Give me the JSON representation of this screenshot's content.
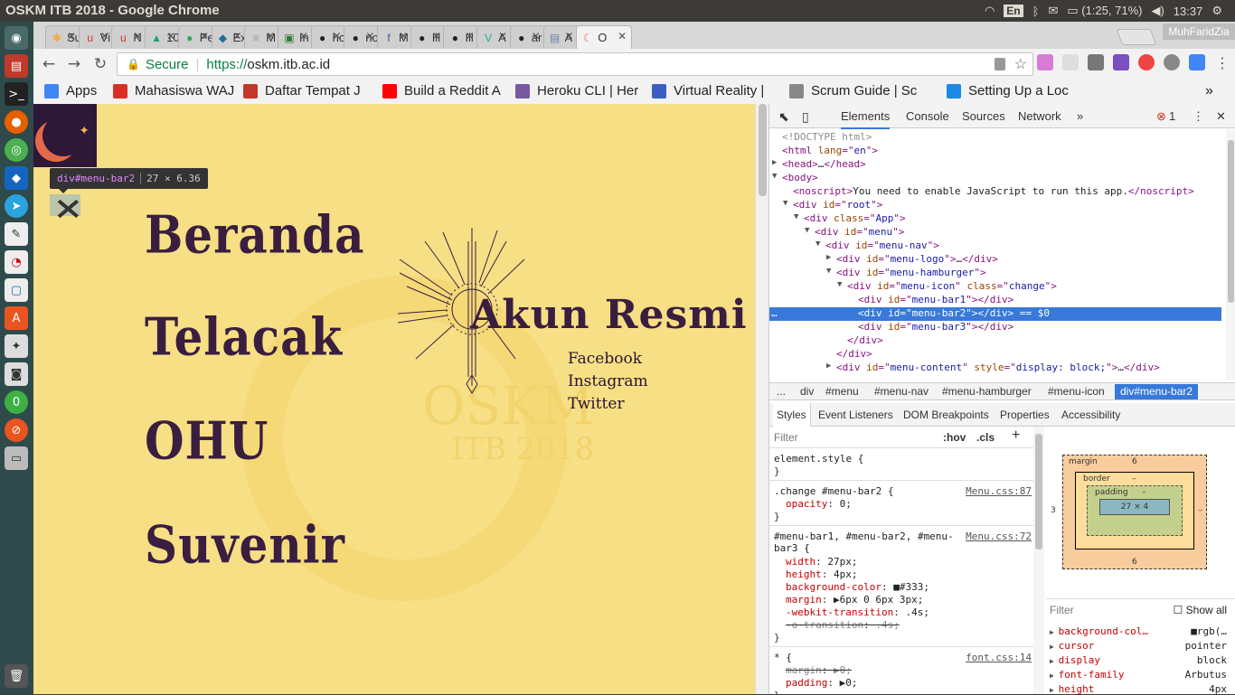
{
  "system": {
    "window_title": "OSKM ITB 2018 - Google Chrome",
    "keyboard_layout": "En",
    "battery": "(1:25, 71%)",
    "clock": "13:37"
  },
  "browser": {
    "profile_name": "MuhFaridZia",
    "tabs": [
      {
        "label": "Su",
        "color": "#f4a742",
        "icon_glyph": "✱"
      },
      {
        "label": "Vi",
        "color": "#d93025",
        "icon_glyph": "u"
      },
      {
        "label": "N",
        "color": "#d93025",
        "icon_glyph": "u"
      },
      {
        "label": "10",
        "color": "#1ea362",
        "icon_glyph": "▲"
      },
      {
        "label": "Pe",
        "color": "#2fa84f",
        "icon_glyph": "●"
      },
      {
        "label": "Ex",
        "color": "#1f6f9f",
        "icon_glyph": "◆"
      },
      {
        "label": "M",
        "color": "#999999",
        "icon_glyph": "≡"
      },
      {
        "label": "In",
        "color": "#2e7d32",
        "icon_glyph": "▣"
      },
      {
        "label": "ho",
        "color": "#222222",
        "icon_glyph": "●"
      },
      {
        "label": "no",
        "color": "#222222",
        "icon_glyph": "●"
      },
      {
        "label": "M",
        "color": "#3b5998",
        "icon_glyph": "f"
      },
      {
        "label": "Ill",
        "color": "#222222",
        "icon_glyph": "●"
      },
      {
        "label": "Ill",
        "color": "#222222",
        "icon_glyph": "●"
      },
      {
        "label": "A",
        "color": "#1fae9b",
        "icon_glyph": "V"
      },
      {
        "label": "ar",
        "color": "#222222",
        "icon_glyph": "●"
      },
      {
        "label": "A",
        "color": "#6f7fa8",
        "icon_glyph": "▤"
      },
      {
        "label": "O",
        "color": "#e4694a",
        "icon_glyph": "☾"
      }
    ],
    "omnibox": {
      "secure_label": "Secure",
      "separator": "|",
      "url_scheme": "https://",
      "url_host": "oskm.itb.ac.id"
    },
    "bookmarks": [
      {
        "label": "Apps",
        "color": "#4285f4"
      },
      {
        "label": "Mahasiswa WAJ",
        "color": "#d93025"
      },
      {
        "label": "Daftar Tempat J",
        "color": "#c0392b"
      },
      {
        "label": "Build a Reddit A",
        "color": "#ff0000"
      },
      {
        "label": "Heroku CLI | Her",
        "color": "#79589f"
      },
      {
        "label": "Virtual Reality |",
        "color": "#3b5fc0"
      },
      {
        "label": "Scrum Guide | Sc",
        "color": "#888888"
      },
      {
        "label": "Setting Up a Loc",
        "color": "#1e88e5"
      }
    ],
    "bookmarks_overflow": "»"
  },
  "page": {
    "nav_links": [
      "Beranda",
      "Telacak",
      "OHU",
      "Suvenir"
    ],
    "akun_title": "Akun Resmi",
    "social_links": [
      "Facebook",
      "Instagram",
      "Twitter"
    ],
    "watermark_main": "OSKM",
    "watermark_sub": "ITB 2018",
    "inspect_tooltip": {
      "tag": "div#menu-bar2",
      "dims": "27 × 6.36"
    }
  },
  "devtools": {
    "tabs": [
      "Elements",
      "Console",
      "Sources",
      "Network"
    ],
    "more": "»",
    "error_count": "1",
    "dom_lines": [
      {
        "indent": 0,
        "arrow": "",
        "parts": [
          [
            "cm",
            "<!DOCTYPE html>"
          ]
        ]
      },
      {
        "indent": 0,
        "arrow": "",
        "parts": [
          [
            "tg",
            "<html "
          ],
          [
            "an",
            "lang"
          ],
          [
            "tg",
            "=\""
          ],
          [
            "av",
            "en"
          ],
          [
            "tg",
            "\">"
          ]
        ]
      },
      {
        "indent": 0,
        "arrow": "▶",
        "parts": [
          [
            "tg",
            "<head>"
          ],
          [
            "tx",
            "…"
          ],
          [
            "tg",
            "</head>"
          ]
        ]
      },
      {
        "indent": 0,
        "arrow": "▼",
        "parts": [
          [
            "tg",
            "<body>"
          ]
        ]
      },
      {
        "indent": 1,
        "arrow": "",
        "parts": [
          [
            "tg",
            "<noscript>"
          ],
          [
            "tx",
            "You need to enable JavaScript to run this app."
          ],
          [
            "tg",
            "</noscript>"
          ]
        ]
      },
      {
        "indent": 1,
        "arrow": "▼",
        "parts": [
          [
            "tg",
            "<div "
          ],
          [
            "an",
            "id"
          ],
          [
            "tg",
            "=\""
          ],
          [
            "av",
            "root"
          ],
          [
            "tg",
            "\">"
          ]
        ]
      },
      {
        "indent": 2,
        "arrow": "▼",
        "parts": [
          [
            "tg",
            "<div "
          ],
          [
            "an",
            "class"
          ],
          [
            "tg",
            "=\""
          ],
          [
            "av",
            "App"
          ],
          [
            "tg",
            "\">"
          ]
        ]
      },
      {
        "indent": 3,
        "arrow": "▼",
        "parts": [
          [
            "tg",
            "<div "
          ],
          [
            "an",
            "id"
          ],
          [
            "tg",
            "=\""
          ],
          [
            "av",
            "menu"
          ],
          [
            "tg",
            "\">"
          ]
        ]
      },
      {
        "indent": 4,
        "arrow": "▼",
        "parts": [
          [
            "tg",
            "<div "
          ],
          [
            "an",
            "id"
          ],
          [
            "tg",
            "=\""
          ],
          [
            "av",
            "menu-nav"
          ],
          [
            "tg",
            "\">"
          ]
        ]
      },
      {
        "indent": 5,
        "arrow": "▶",
        "parts": [
          [
            "tg",
            "<div "
          ],
          [
            "an",
            "id"
          ],
          [
            "tg",
            "=\""
          ],
          [
            "av",
            "menu-logo"
          ],
          [
            "tg",
            "\">"
          ],
          [
            "tx",
            "…"
          ],
          [
            "tg",
            "</div>"
          ]
        ]
      },
      {
        "indent": 5,
        "arrow": "▼",
        "parts": [
          [
            "tg",
            "<div "
          ],
          [
            "an",
            "id"
          ],
          [
            "tg",
            "=\""
          ],
          [
            "av",
            "menu-hamburger"
          ],
          [
            "tg",
            "\">"
          ]
        ]
      },
      {
        "indent": 6,
        "arrow": "▼",
        "parts": [
          [
            "tg",
            "<div "
          ],
          [
            "an",
            "id"
          ],
          [
            "tg",
            "=\""
          ],
          [
            "av",
            "menu-icon"
          ],
          [
            "tg",
            "\" "
          ],
          [
            "an",
            "class"
          ],
          [
            "tg",
            "=\""
          ],
          [
            "av",
            "change"
          ],
          [
            "tg",
            "\">"
          ]
        ]
      },
      {
        "indent": 7,
        "arrow": "",
        "parts": [
          [
            "tg",
            "<div "
          ],
          [
            "an",
            "id"
          ],
          [
            "tg",
            "=\""
          ],
          [
            "av",
            "menu-bar1"
          ],
          [
            "tg",
            "\"></div>"
          ]
        ]
      },
      {
        "indent": 7,
        "arrow": "",
        "selected": true,
        "parts": [
          [
            "tg",
            "<div "
          ],
          [
            "an",
            "id"
          ],
          [
            "tg",
            "=\""
          ],
          [
            "av",
            "menu-bar2"
          ],
          [
            "tg",
            "\"></div>"
          ],
          [
            "tx",
            " == $0"
          ]
        ]
      },
      {
        "indent": 7,
        "arrow": "",
        "parts": [
          [
            "tg",
            "<div "
          ],
          [
            "an",
            "id"
          ],
          [
            "tg",
            "=\""
          ],
          [
            "av",
            "menu-bar3"
          ],
          [
            "tg",
            "\"></div>"
          ]
        ]
      },
      {
        "indent": 6,
        "arrow": "",
        "parts": [
          [
            "tg",
            "</div>"
          ]
        ]
      },
      {
        "indent": 5,
        "arrow": "",
        "parts": [
          [
            "tg",
            "</div>"
          ]
        ]
      },
      {
        "indent": 5,
        "arrow": "▶",
        "parts": [
          [
            "tg",
            "<div "
          ],
          [
            "an",
            "id"
          ],
          [
            "tg",
            "=\""
          ],
          [
            "av",
            "menu-content"
          ],
          [
            "tg",
            "\" "
          ],
          [
            "an",
            "style"
          ],
          [
            "tg",
            "=\""
          ],
          [
            "av",
            "display: block;"
          ],
          [
            "tg",
            "\">"
          ],
          [
            "tx",
            "…"
          ],
          [
            "tg",
            "</div>"
          ]
        ]
      }
    ],
    "breadcrumbs": [
      "...",
      "div",
      "#menu",
      "#menu-nav",
      "#menu-hamburger",
      "#menu-icon",
      "div#menu-bar2"
    ],
    "sub_tabs": [
      "Styles",
      "Event Listeners",
      "DOM Breakpoints",
      "Properties",
      "Accessibility"
    ],
    "styles": {
      "filter_placeholder": "Filter",
      "hov": ":hov",
      "cls": ".cls",
      "add": "+",
      "rules": [
        {
          "selector": "element.style {",
          "source": "",
          "props": [],
          "close": "}"
        },
        {
          "selector": ".change #menu-bar2 {",
          "source": "Menu.css:87",
          "props": [
            [
              "opacity",
              "0;"
            ]
          ],
          "close": "}"
        },
        {
          "selector": "#menu-bar1, #menu-bar2, #menu-bar3 {",
          "source": "Menu.css:72",
          "props": [
            [
              "width",
              "27px;"
            ],
            [
              "height",
              "4px;"
            ],
            [
              "background-color",
              "■#333;"
            ],
            [
              "margin",
              "▶6px 0 6px 3px;"
            ],
            [
              "-webkit-transition",
              ".4s;"
            ],
            [
              "-o-transition",
              ".4s;"
            ]
          ],
          "close": "}"
        },
        {
          "selector": "* {",
          "source": "font.css:14",
          "props": [
            [
              "margin",
              "▶0;"
            ],
            [
              "padding",
              "▶0;"
            ]
          ],
          "close": "}"
        }
      ]
    },
    "box_model": {
      "margin_label": "margin",
      "margin_top": "6",
      "margin_bottom": "6",
      "margin_left": "3",
      "margin_right": "–",
      "border_label": "border",
      "border_value": "–",
      "padding_label": "padding",
      "padding_value": "–",
      "content": "27 × 4"
    },
    "computed": {
      "filter_placeholder": "Filter",
      "show_all": "Show all",
      "props": [
        {
          "name": "background-col…",
          "value": "■rgb(…"
        },
        {
          "name": "cursor",
          "value": "pointer"
        },
        {
          "name": "display",
          "value": "block"
        },
        {
          "name": "font-family",
          "value": "Arbutus"
        },
        {
          "name": "height",
          "value": "4px"
        }
      ]
    }
  }
}
